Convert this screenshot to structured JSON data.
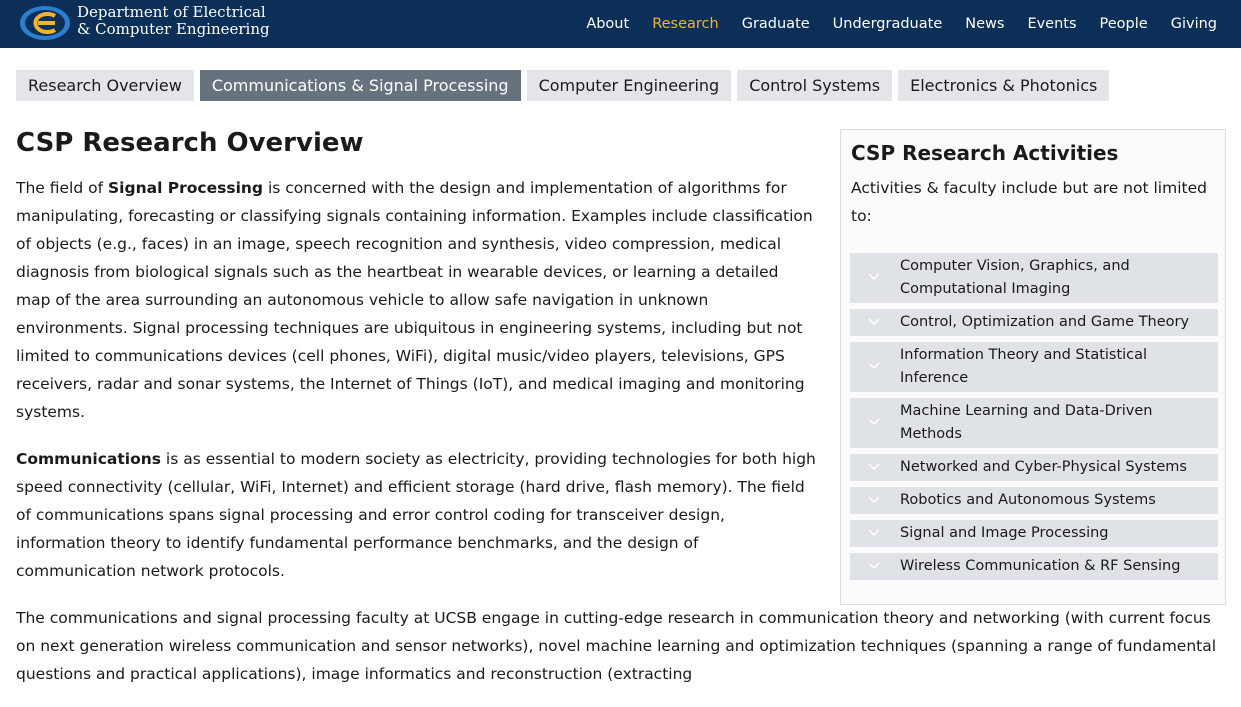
{
  "header": {
    "brand_line1": "Department of Electrical",
    "brand_line2": "& Computer Engineering",
    "nav": [
      "About",
      "Research",
      "Graduate",
      "Undergraduate",
      "News",
      "Events",
      "People",
      "Giving"
    ],
    "active_nav": "Research",
    "bg_color": "#0b2f57",
    "accent_color": "#f2b233"
  },
  "tabs": {
    "items": [
      "Research Overview",
      "Communications & Signal Processing",
      "Computer Engineering",
      "Control Systems",
      "Electronics & Photonics"
    ],
    "active": "Communications & Signal Processing"
  },
  "main": {
    "title": "CSP Research Overview",
    "p1": {
      "pre": "The field of ",
      "bold": "Signal Processing",
      "post": " is concerned with the design and implementation of algorithms for manipulating, forecasting or classifying signals containing information. Examples include classification of objects (e.g., faces) in an image, speech recognition and synthesis, video compression, medical diagnosis from biological signals such as the heartbeat in wearable devices, or learning a detailed map of the area surrounding an autonomous vehicle to allow safe navigation in unknown environments.  Signal processing techniques are ubiquitous in engineering systems, including but not limited to communications devices (cell phones, WiFi), digital music/video players, televisions, GPS receivers, radar and sonar systems, the Internet of Things (IoT), and medical imaging and monitoring systems."
    },
    "p2": {
      "bold": "Communications",
      "post": " is as essential to modern society as electricity, providing technologies for both high speed connectivity (cellular, WiFi, Internet) and efficient storage (hard drive, flash memory). The field of communications spans signal processing and error control coding for transceiver design, information theory to identify fundamental performance benchmarks, and the design of communication network protocols."
    },
    "p3": "The communications and signal processing faculty at UCSB engage in cutting-edge research in communication theory and networking (with current focus on next generation wireless communication and sensor networks), novel machine learning and optimization techniques (spanning a range of fundamental questions and practical applications), image informatics and reconstruction (extracting"
  },
  "sidebar": {
    "title": "CSP Research Activities",
    "intro": "Activities & faculty include but are not limited to:",
    "items": [
      "Computer Vision, Graphics, and Computational Imaging",
      "Control, Optimization and Game Theory",
      "Information Theory and Statistical Inference",
      "Machine Learning and Data-Driven Methods",
      "Networked and Cyber-Physical Systems",
      "Robotics and Autonomous Systems",
      "Signal and Image Processing",
      "Wireless Communication & RF Sensing"
    ]
  }
}
